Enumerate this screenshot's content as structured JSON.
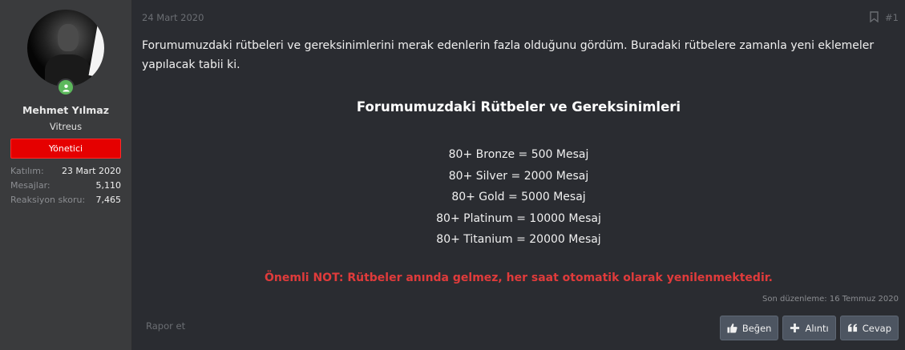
{
  "user": {
    "name": "Mehmet Yılmaz",
    "title": "Vitreus",
    "role": "Yönetici",
    "stats": [
      {
        "label": "Katılım:",
        "value": "23 Mart 2020"
      },
      {
        "label": "Mesajlar:",
        "value": "5,110"
      },
      {
        "label": "Reaksiyon skoru:",
        "value": "7,465"
      }
    ]
  },
  "post": {
    "date": "24 Mart 2020",
    "number": "#1",
    "intro": "Forumumuzdaki rütbeleri ve gereksinimlerini merak edenlerin fazla olduğunu gördüm. Buradaki rütbelere zamanla yeni eklemeler yapılacak tabii ki.",
    "heading": "Forumumuzdaki Rütbeler ve Gereksinimleri",
    "ranks": [
      "80+ Bronze = 500 Mesaj",
      "80+ Silver = 2000 Mesaj",
      "80+ Gold = 5000 Mesaj",
      "80+ Platinum = 10000 Mesaj",
      "80+ Titanium = 20000 Mesaj"
    ],
    "note": "Önemli NOT: Rütbeler anında gelmez, her saat otomatik olarak yenilenmektedir.",
    "edited": "Son düzenleme: 16 Temmuz 2020",
    "report": "Rapor et"
  },
  "actions": {
    "like": "Beğen",
    "quote": "Alıntı",
    "reply": "Cevap"
  },
  "colors": {
    "role_banner": "#e50000",
    "note_text": "#e03b3b",
    "online": "#5cb85c",
    "sidebar_bg": "#3a3b3d",
    "main_bg": "#2a2c31"
  }
}
